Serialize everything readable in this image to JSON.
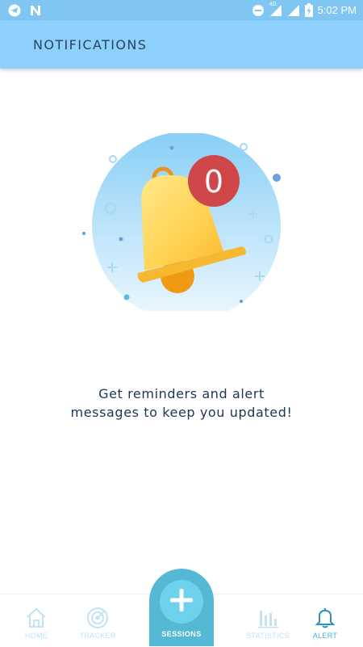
{
  "status_bar": {
    "time": "5:02 PM",
    "network": "4G",
    "icons": [
      "telegram-icon",
      "n-icon",
      "minus-circle-icon",
      "signal-icon",
      "signal-icon",
      "battery-charging-icon"
    ]
  },
  "header": {
    "title": "NOTIFICATIONS"
  },
  "notifications": {
    "badge_count": "0",
    "message_line1": "Get reminders and alert",
    "message_line2": "messages to keep you updated!"
  },
  "bottom_nav": {
    "items": [
      {
        "label": "HOME",
        "icon": "home-icon",
        "active": false
      },
      {
        "label": "TRACKER",
        "icon": "target-icon",
        "active": false
      },
      {
        "label": "SESSIONS",
        "icon": "plus-icon",
        "active": false
      },
      {
        "label": "STATISTICS",
        "icon": "bar-chart-icon",
        "active": false
      },
      {
        "label": "ALERT",
        "icon": "bell-icon",
        "active": true
      }
    ]
  },
  "colors": {
    "status_bar": "#7fc6f2",
    "header": "#8dd0fb",
    "header_text": "#28435f",
    "badge": "#d0474a",
    "bell": "#ffd45a",
    "sessions_tab": "#55b8d4",
    "active_nav": "#4aaed8",
    "inactive_nav": "#bfe2f5"
  }
}
